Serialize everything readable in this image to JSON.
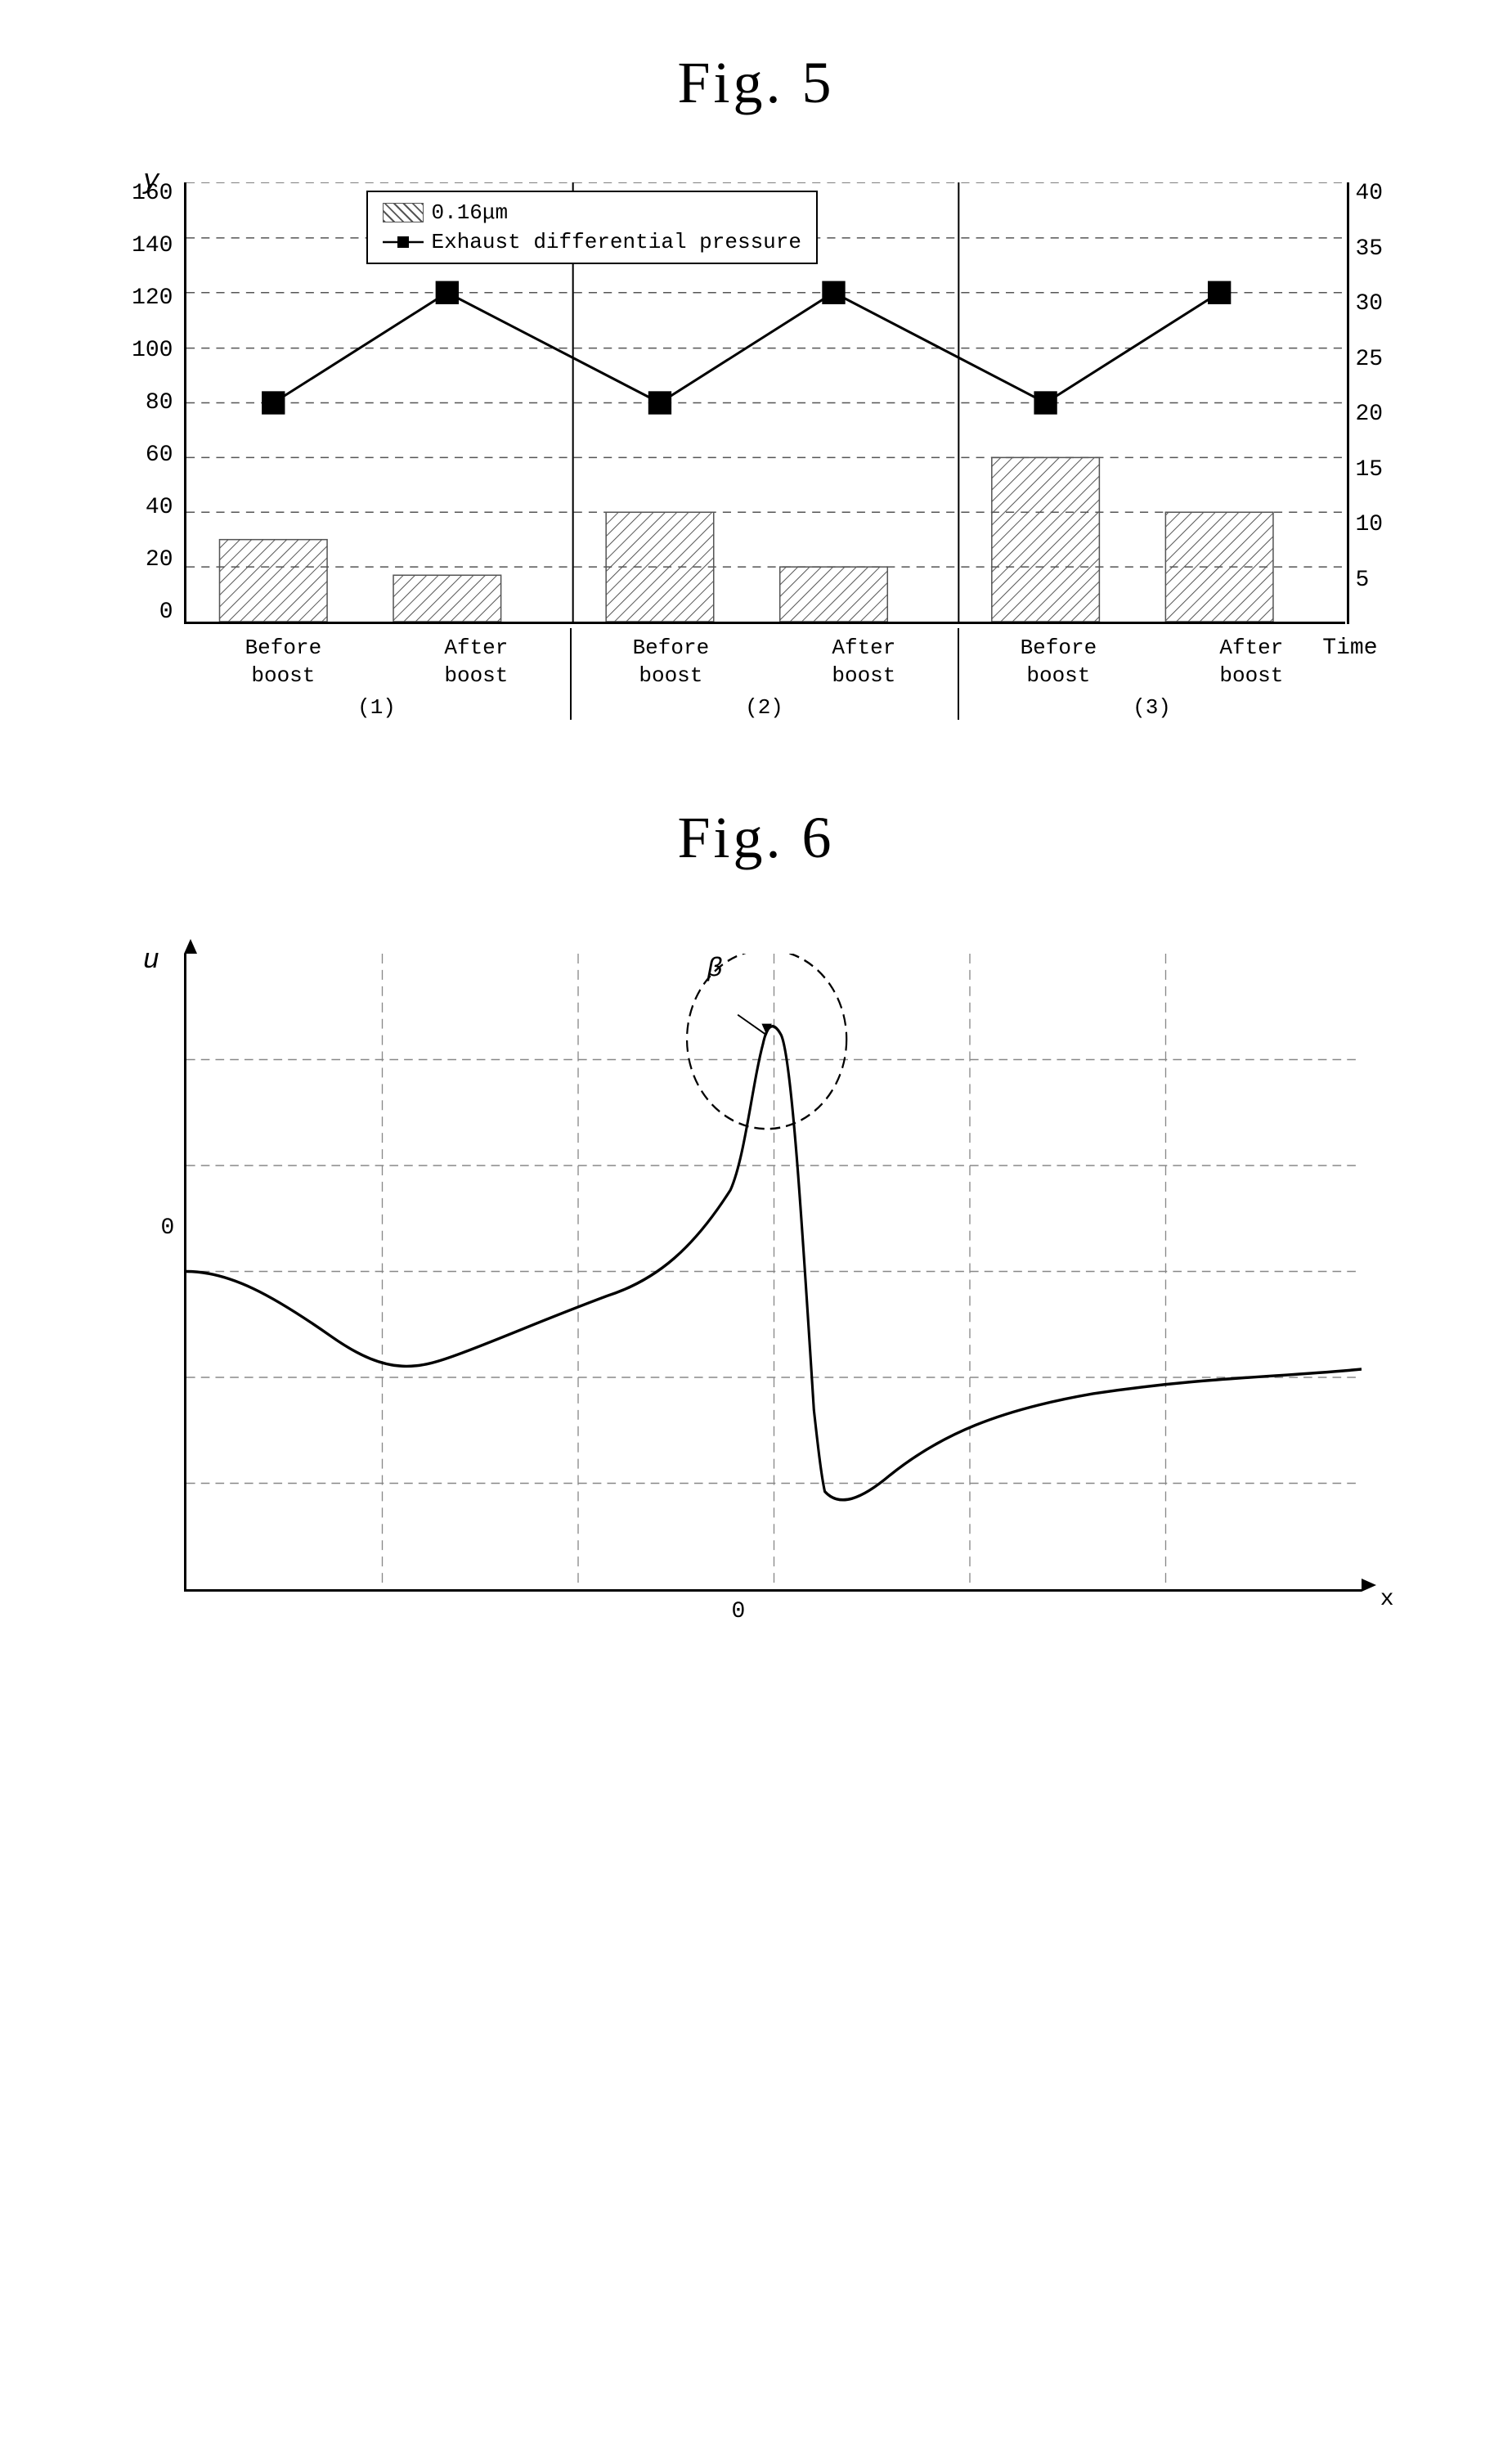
{
  "fig5": {
    "title": "Fig. 5",
    "y_axis_label": "y",
    "time_label": "Time",
    "y_left_values": [
      "0",
      "20",
      "40",
      "60",
      "80",
      "100",
      "120",
      "140",
      "160"
    ],
    "y_right_values": [
      "",
      "5",
      "10",
      "15",
      "20",
      "25",
      "30",
      "35",
      "40"
    ],
    "legend": {
      "hatch_label": "0.16μm",
      "line_label": "Exhaust differential pressure"
    },
    "groups": [
      {
        "label": "(1)",
        "before_label": "Before\nboost",
        "after_label": "After\nboost",
        "before_bar_height_pct": 30,
        "after_bar_height_pct": 17,
        "line_before_y_pct": 50,
        "line_after_y_pct": 78
      },
      {
        "label": "(2)",
        "before_label": "Before\nboost",
        "after_label": "After\nboost",
        "before_bar_height_pct": 38,
        "after_bar_height_pct": 20,
        "line_before_y_pct": 50,
        "line_after_y_pct": 78
      },
      {
        "label": "(3)",
        "before_label": "Before\nboost",
        "after_label": "After\nboost",
        "before_bar_height_pct": 58,
        "after_bar_height_pct": 37,
        "line_before_y_pct": 50,
        "line_after_y_pct": 78
      }
    ]
  },
  "fig6": {
    "title": "Fig. 6",
    "u_label": "u",
    "x_label": "x",
    "zero_label": "0",
    "origin_label": "0",
    "beta_label": "β"
  }
}
